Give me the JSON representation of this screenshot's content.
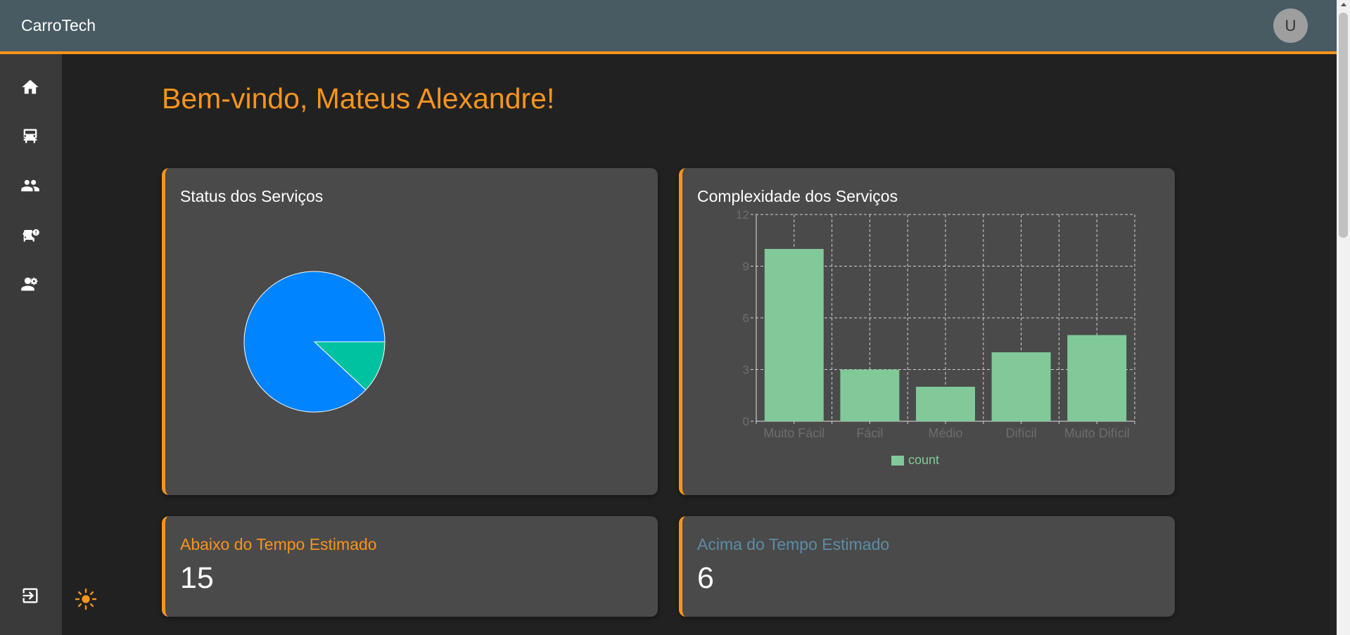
{
  "app": {
    "brand": "CarroTech",
    "avatar_initial": "U"
  },
  "sidebar": {
    "items": [
      {
        "icon": "home-icon"
      },
      {
        "icon": "car-icon"
      },
      {
        "icon": "people-icon"
      },
      {
        "icon": "car-alert-icon"
      },
      {
        "icon": "engineer-icon"
      }
    ],
    "logout_icon": "logout-icon"
  },
  "theme_toggle_icon": "sun-icon",
  "welcome": "Bem-vindo, Mateus Alexandre!",
  "cards": {
    "status": {
      "title": "Status dos Serviços"
    },
    "complexity": {
      "title": "Complexidade dos Serviços"
    },
    "below": {
      "title": "Abaixo do Tempo Estimado",
      "value": "15"
    },
    "above": {
      "title": "Acima do Tempo Estimado",
      "value": "6"
    }
  },
  "colors": {
    "accent": "#f7941d",
    "topbar": "#485a62",
    "card": "#4a4a4a",
    "above_title": "#5c8ca7",
    "bar": "#82c99a",
    "pie_blue": "#0084ff",
    "pie_teal": "#00c2a0"
  },
  "chart_data": [
    {
      "type": "pie",
      "title": "Status dos Serviços",
      "slices": [
        {
          "value": 88,
          "color": "#0084ff"
        },
        {
          "value": 12,
          "color": "#00c2a0"
        }
      ]
    },
    {
      "type": "bar",
      "title": "Complexidade dos Serviços",
      "categories": [
        "Muito Fácil",
        "Fácil",
        "Médio",
        "Difícil",
        "Muito Difícil"
      ],
      "series": [
        {
          "name": "count",
          "values": [
            10,
            3,
            2,
            4,
            5
          ]
        }
      ],
      "ylim": [
        0,
        12
      ],
      "yticks": [
        0,
        3,
        6,
        9,
        12
      ],
      "grid": true,
      "legend": "bottom"
    }
  ]
}
